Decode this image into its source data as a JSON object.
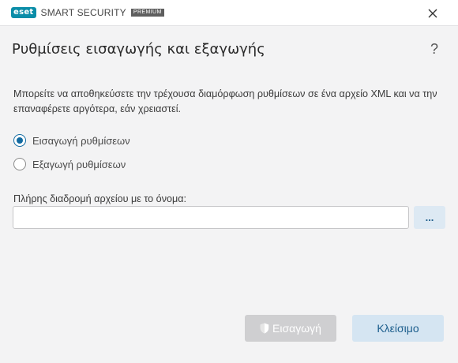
{
  "titlebar": {
    "brand_badge": "eset",
    "product_name": "SMART SECURITY",
    "edition": "PREMIUM"
  },
  "page": {
    "title": "Ρυθμίσεις εισαγωγής και εξαγωγής",
    "help": "?",
    "description": "Μπορείτε να αποθηκεύσετε την τρέχουσα διαμόρφωση ρυθμίσεων σε ένα αρχείο XML και να την επαναφέρετε αργότερα, εάν χρειαστεί."
  },
  "options": {
    "import_label": "Εισαγωγή ρυθμίσεων",
    "export_label": "Εξαγωγή ρυθμίσεων",
    "selected": "import"
  },
  "file_path": {
    "label": "Πλήρης διαδρομή αρχείου με το όνομα:",
    "value": "",
    "browse_label": "..."
  },
  "buttons": {
    "import_label": "Εισαγωγή",
    "import_enabled": false,
    "close_label": "Κλείσιμο"
  },
  "colors": {
    "accent": "#126aa1",
    "brand": "#0b8da8",
    "secondary_button_bg": "#d5e5f2",
    "disabled_button_bg": "#cfcfd1"
  },
  "icons": {
    "close": "close-icon",
    "shield": "shield-icon"
  }
}
